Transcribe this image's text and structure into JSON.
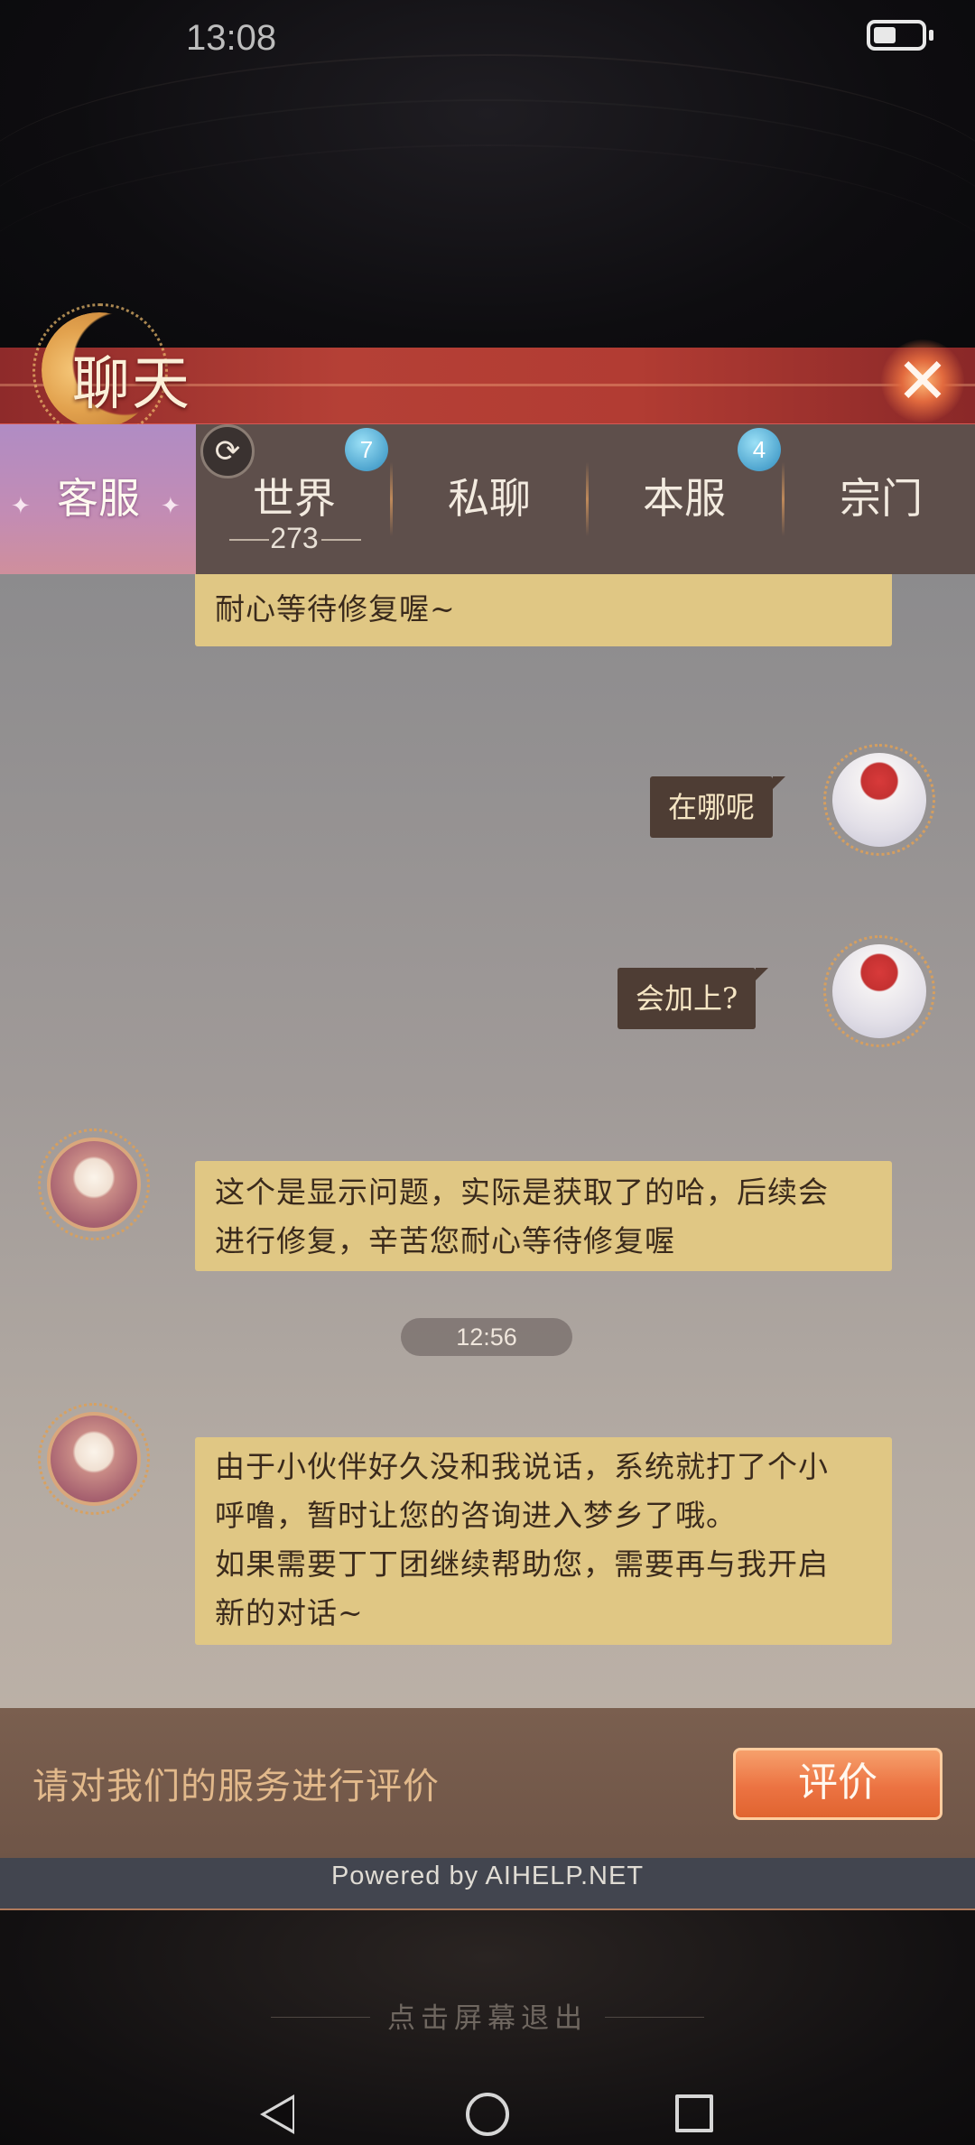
{
  "status_bar": {
    "time": "13:08"
  },
  "header": {
    "title": "聊天",
    "close_icon": "close-icon"
  },
  "tabs": [
    {
      "label": "客服",
      "active": true
    },
    {
      "label": "世界",
      "badge": "7",
      "count": "273"
    },
    {
      "label": "私聊"
    },
    {
      "label": "本服",
      "badge": "4"
    },
    {
      "label": "宗门"
    }
  ],
  "messages": [
    {
      "from": "cs",
      "text": "实际是获取了的哈，后续会进行修复，辛苦您耐心等待修复喔~",
      "partial_line2": "耐心等待修复喔~"
    },
    {
      "from": "user",
      "text": "在哪呢"
    },
    {
      "from": "user",
      "text": "会加上?"
    },
    {
      "from": "cs",
      "lines": [
        "这个是显示问题，实际是获取了的哈，后续会",
        "进行修复，辛苦您耐心等待修复喔"
      ]
    },
    {
      "from": "time",
      "text": "12:56"
    },
    {
      "from": "cs",
      "lines": [
        "由于小伙伴好久没和我说话，系统就打了个小",
        "呼噜，暂时让您的咨询进入梦乡了哦。",
        "如果需要丁丁团继续帮助您，需要再与我开启",
        "新的对话~"
      ]
    }
  ],
  "rating": {
    "prompt": "请对我们的服务进行评价",
    "button_label": "评价"
  },
  "footer": {
    "powered_by": "Powered by AIHELP.NET",
    "exit_hint": "点击屏幕退出"
  },
  "colors": {
    "cs_bubble": "#e0c784",
    "user_bubble": "#4e3d34",
    "title_bar": "#b54036",
    "rate_button": "#ec7342",
    "badge": "#4fa5cf"
  }
}
